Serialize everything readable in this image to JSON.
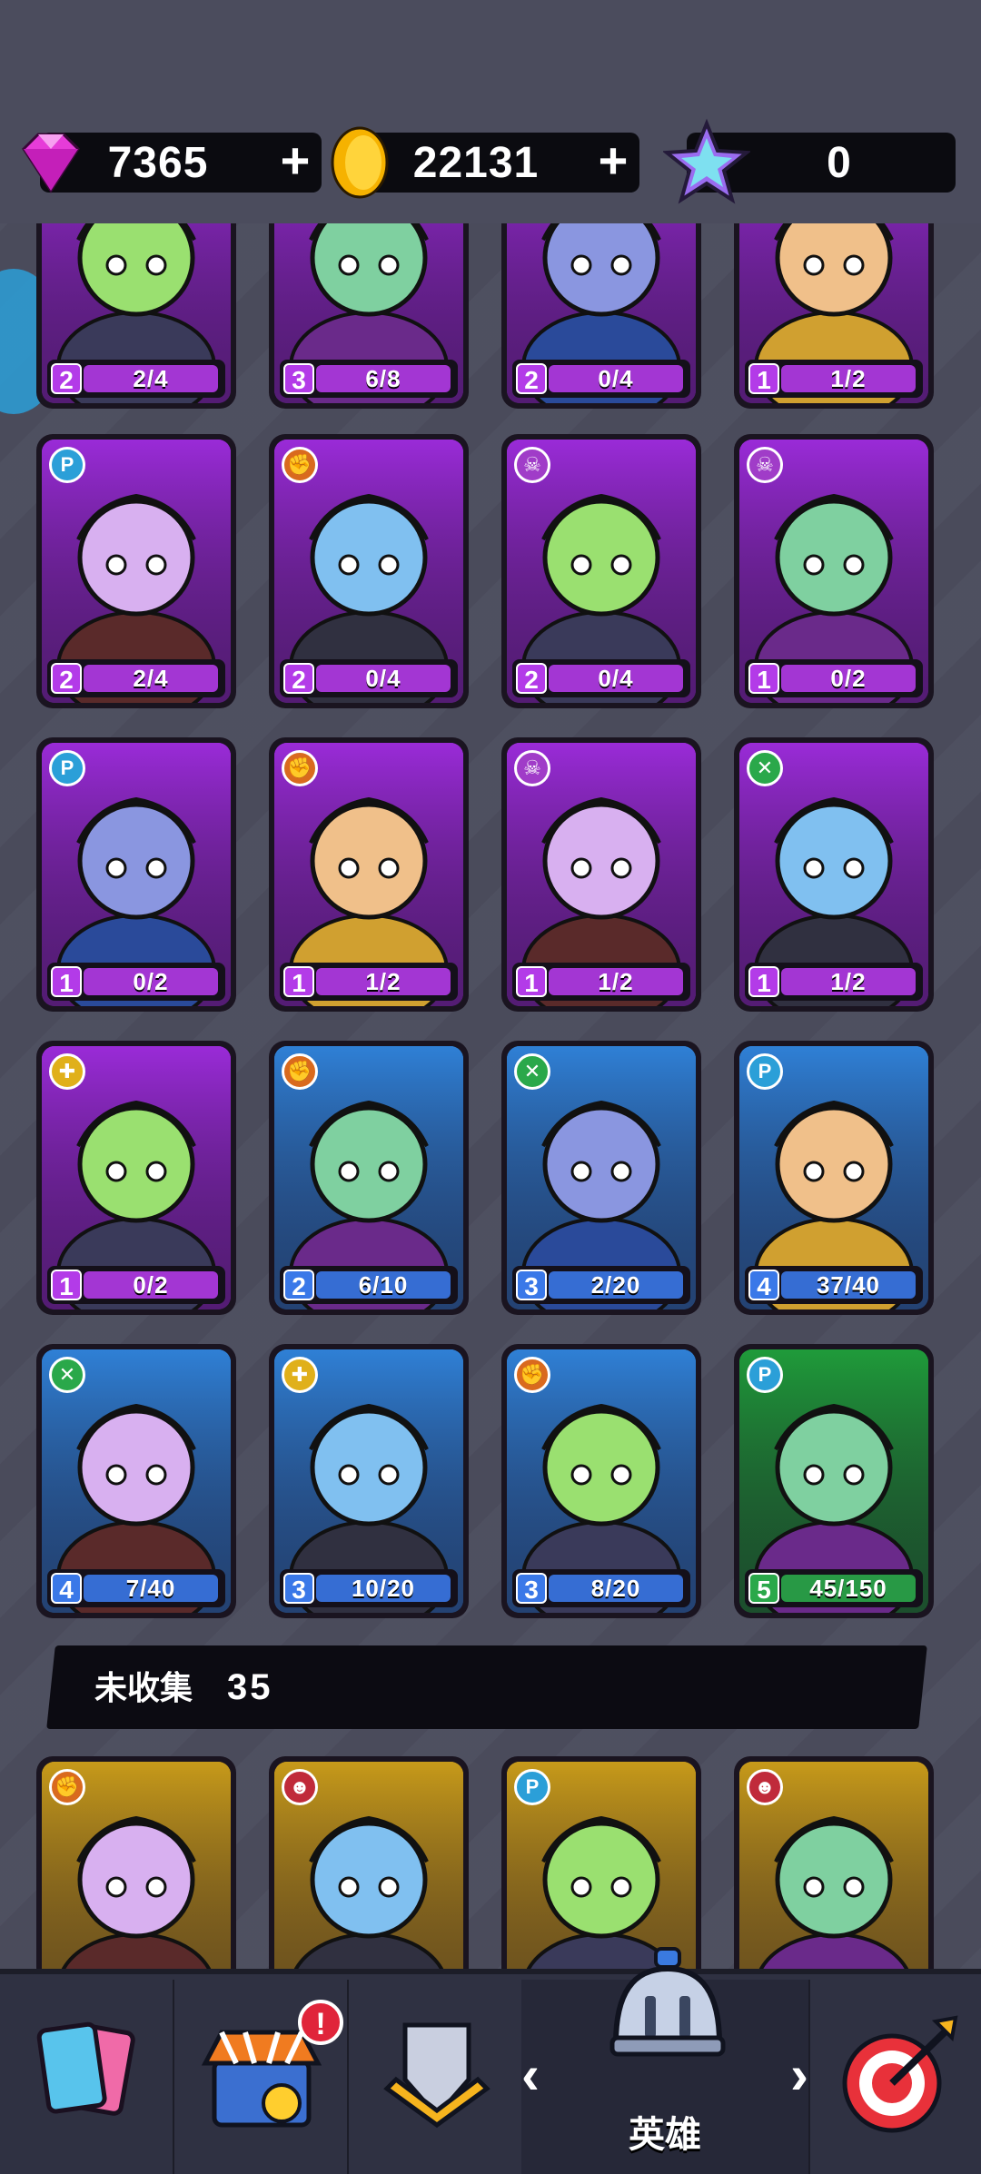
{
  "currency": {
    "gems": "7365",
    "coins": "22131",
    "stars": "0",
    "plus_label": "+"
  },
  "colors": {
    "purple_card": "#9a2bd8",
    "blue_card": "#2f80d6",
    "green_card": "#1f9b3a",
    "gold_card": "#c79a1a"
  },
  "collected_rows": [
    [
      {
        "level": "2",
        "progress": "2/4",
        "rarity": "purple",
        "class": "none",
        "fill": 0.5
      },
      {
        "level": "3",
        "progress": "6/8",
        "rarity": "purple",
        "class": "none",
        "fill": 0.75
      },
      {
        "level": "2",
        "progress": "0/4",
        "rarity": "purple",
        "class": "none",
        "fill": 0
      },
      {
        "level": "1",
        "progress": "1/2",
        "rarity": "purple",
        "class": "none",
        "fill": 0.5
      }
    ],
    [
      {
        "level": "2",
        "progress": "2/4",
        "rarity": "purple",
        "class": "P",
        "fill": 0.5
      },
      {
        "level": "2",
        "progress": "0/4",
        "rarity": "purple",
        "class": "fist",
        "fill": 0
      },
      {
        "level": "2",
        "progress": "0/4",
        "rarity": "purple",
        "class": "skull",
        "fill": 0
      },
      {
        "level": "1",
        "progress": "0/2",
        "rarity": "purple",
        "class": "skull",
        "fill": 0
      }
    ],
    [
      {
        "level": "1",
        "progress": "0/2",
        "rarity": "purple",
        "class": "P",
        "fill": 0
      },
      {
        "level": "1",
        "progress": "1/2",
        "rarity": "purple",
        "class": "fist",
        "fill": 0.5
      },
      {
        "level": "1",
        "progress": "1/2",
        "rarity": "purple",
        "class": "skull",
        "fill": 0.5
      },
      {
        "level": "1",
        "progress": "1/2",
        "rarity": "purple",
        "class": "bow",
        "fill": 0.5
      }
    ],
    [
      {
        "level": "1",
        "progress": "0/2",
        "rarity": "purple",
        "class": "heal",
        "fill": 0
      },
      {
        "level": "2",
        "progress": "6/10",
        "rarity": "blue",
        "class": "fist",
        "fill": 0.6
      },
      {
        "level": "3",
        "progress": "2/20",
        "rarity": "blue",
        "class": "bow",
        "fill": 0.1
      },
      {
        "level": "4",
        "progress": "37/40",
        "rarity": "blue",
        "class": "P",
        "fill": 0.925
      }
    ],
    [
      {
        "level": "4",
        "progress": "7/40",
        "rarity": "blue",
        "class": "bow",
        "fill": 0.175
      },
      {
        "level": "3",
        "progress": "10/20",
        "rarity": "blue",
        "class": "heal",
        "fill": 0.5
      },
      {
        "level": "3",
        "progress": "8/20",
        "rarity": "blue",
        "class": "fist",
        "fill": 0.4
      },
      {
        "level": "5",
        "progress": "45/150",
        "rarity": "green",
        "class": "P",
        "fill": 0.3
      }
    ]
  ],
  "uncollected": {
    "label": "未收集",
    "count": "35"
  },
  "uncollected_row": [
    {
      "rarity": "gold",
      "class": "fist"
    },
    {
      "rarity": "gold",
      "class": "demon"
    },
    {
      "rarity": "gold",
      "class": "P"
    },
    {
      "rarity": "gold",
      "class": "demon"
    }
  ],
  "nav": {
    "items": [
      "cards",
      "shop",
      "battle",
      "heroes",
      "target"
    ],
    "active_label": "英雄",
    "shop_badge": "!"
  }
}
